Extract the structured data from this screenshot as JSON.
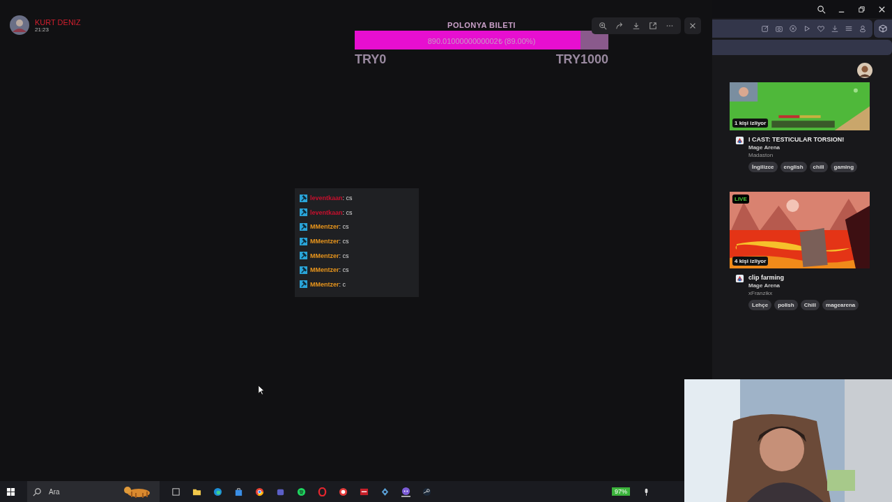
{
  "streamer": {
    "name": "KURT DENIZ",
    "time": "21:23"
  },
  "goal": {
    "title": "POLONYA BILETI",
    "reading": "890.0100000000002₺ (89.00%)",
    "level": 0.89,
    "min": "TRY0",
    "max": "TRY1000"
  },
  "chat": [
    {
      "user": "leventkaan",
      "text": ": cs",
      "color": "#c8102e"
    },
    {
      "user": "leventkaan",
      "text": ": cs",
      "color": "#c8102e"
    },
    {
      "user": "MMentzer",
      "text": ": cs",
      "color": "#e8951c"
    },
    {
      "user": "MMentzer",
      "text": ": cs",
      "color": "#e8951c"
    },
    {
      "user": "MMentzer",
      "text": ": cs",
      "color": "#e8951c"
    },
    {
      "user": "MMentzer",
      "text": ": cs",
      "color": "#e8951c"
    },
    {
      "user": "MMentzer",
      "text": ": c",
      "color": "#e8951c"
    }
  ],
  "browser": {
    "cards": [
      {
        "live": false,
        "viewers": "1 kişi izliyor",
        "title": "I CAST: TESTICULAR TORSION!",
        "category": "Mage Arena",
        "channel": "Madaston",
        "tags": [
          "İngilizce",
          "english",
          "chill",
          "gaming"
        ]
      },
      {
        "live": true,
        "live_label": "LIVE",
        "viewers": "4 kişi izliyor",
        "title": "clip farming",
        "category": "Mage Arena",
        "channel": "xFranzikx",
        "tags": [
          "Lehçe",
          "polish",
          "Chill",
          "magearena"
        ]
      }
    ]
  },
  "taskbar": {
    "search": {
      "placeholder": "Ara"
    },
    "battery": "97%"
  }
}
